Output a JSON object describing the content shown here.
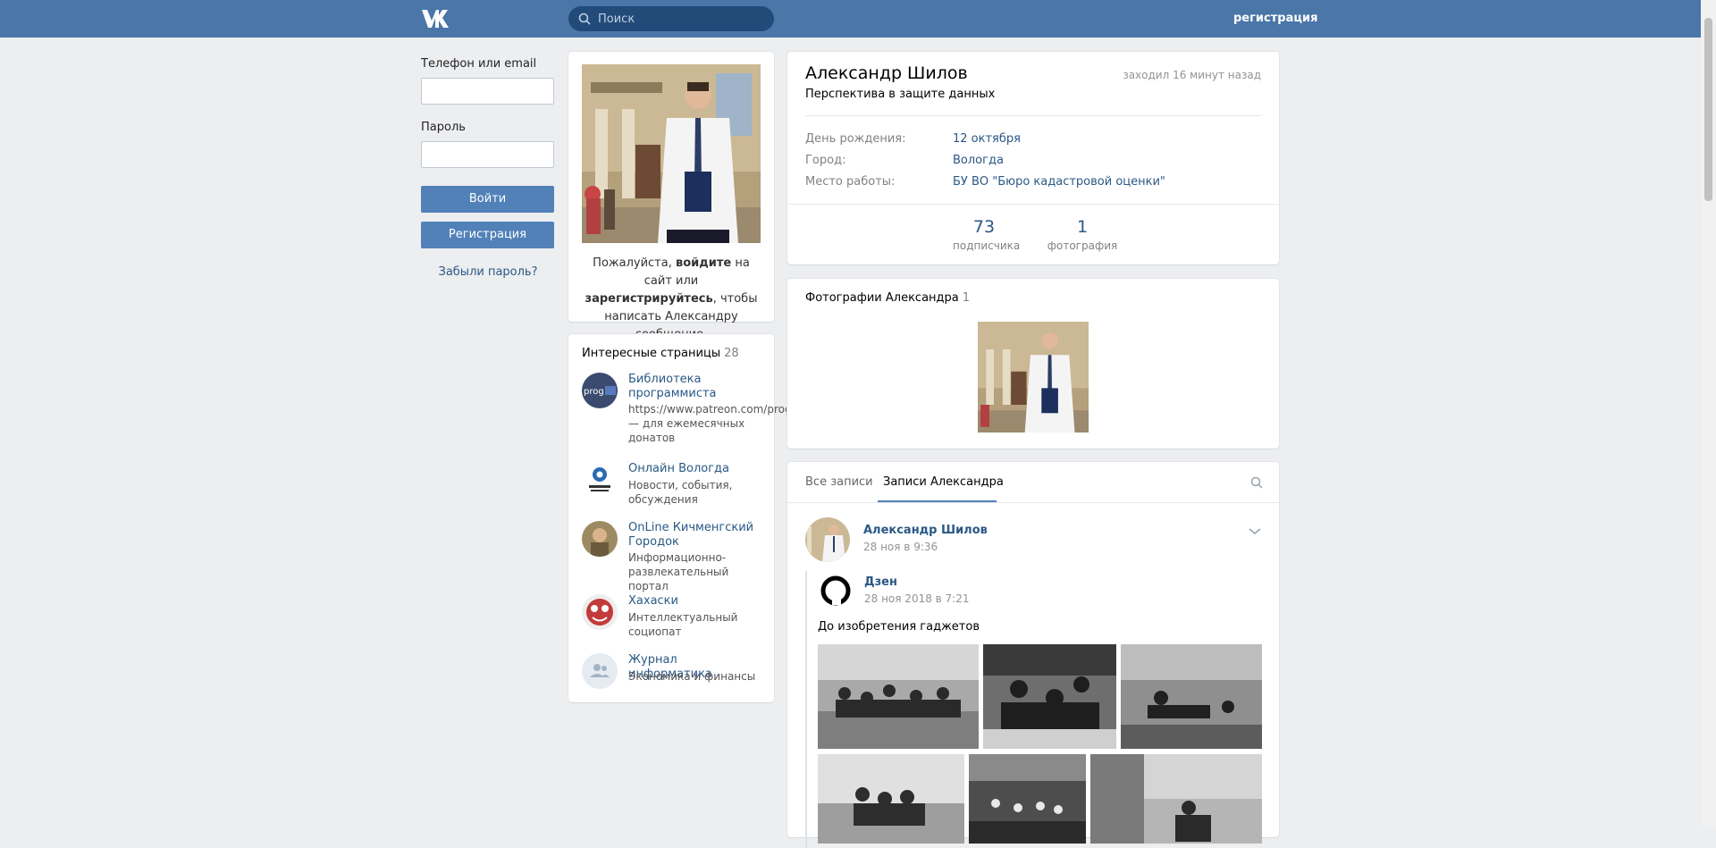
{
  "header": {
    "search_placeholder": "Поиск",
    "register_link": "регистрация"
  },
  "login": {
    "phone_label": "Телефон или email",
    "password_label": "Пароль",
    "login_button": "Войти",
    "register_button": "Регистрация",
    "forgot_link": "Забыли пароль?"
  },
  "avatar_card": {
    "msg_pre": "Пожалуйста, ",
    "msg_login": "войдите",
    "msg_mid": " на сайт или ",
    "msg_register": "зарегистрируйтесь",
    "msg_post": ", чтобы написать Александру сообщение."
  },
  "interesting": {
    "title": "Интересные страницы",
    "count": "28",
    "items": [
      {
        "name": "Библиотека программиста",
        "desc": "https://www.patreon.com/proglib/ — для ежемесячных донатов"
      },
      {
        "name": "Онлайн Вологда",
        "desc": "Новости, события, обсуждения"
      },
      {
        "name": "OnLine Кичменгский Городок",
        "desc": "Информационно-развлекательный портал"
      },
      {
        "name": "Хахаски",
        "desc": "Интеллектуальный социопат"
      },
      {
        "name": "Журнал информатика",
        "desc": "Экономика и финансы"
      }
    ]
  },
  "profile": {
    "name": "Александр Шилов",
    "status": "Перспектива в защите данных",
    "online": "заходил 16 минут назад",
    "rows": [
      {
        "key": "День рождения:",
        "value": "12 октября"
      },
      {
        "key": "Город:",
        "value": "Вологда"
      },
      {
        "key": "Место работы:",
        "value": "БУ ВО \"Бюро кадастровой оценки\""
      }
    ],
    "counters": [
      {
        "num": "73",
        "label": "подписчика"
      },
      {
        "num": "1",
        "label": "фотография"
      }
    ]
  },
  "photos": {
    "title": "Фотографии Александра",
    "count": "1"
  },
  "wall": {
    "tabs": [
      "Все записи",
      "Записи Александра"
    ],
    "post": {
      "author": "Александр Шилов",
      "date": "28 ноя в 9:36",
      "repost_author": "Дзен",
      "repost_date": "28 ноя 2018 в 7:21",
      "text": "До изобретения гаджетов"
    }
  },
  "colors": {
    "header": "#4a76a8",
    "link": "#2a5885",
    "button": "#5181b8",
    "background": "#edeef0"
  }
}
